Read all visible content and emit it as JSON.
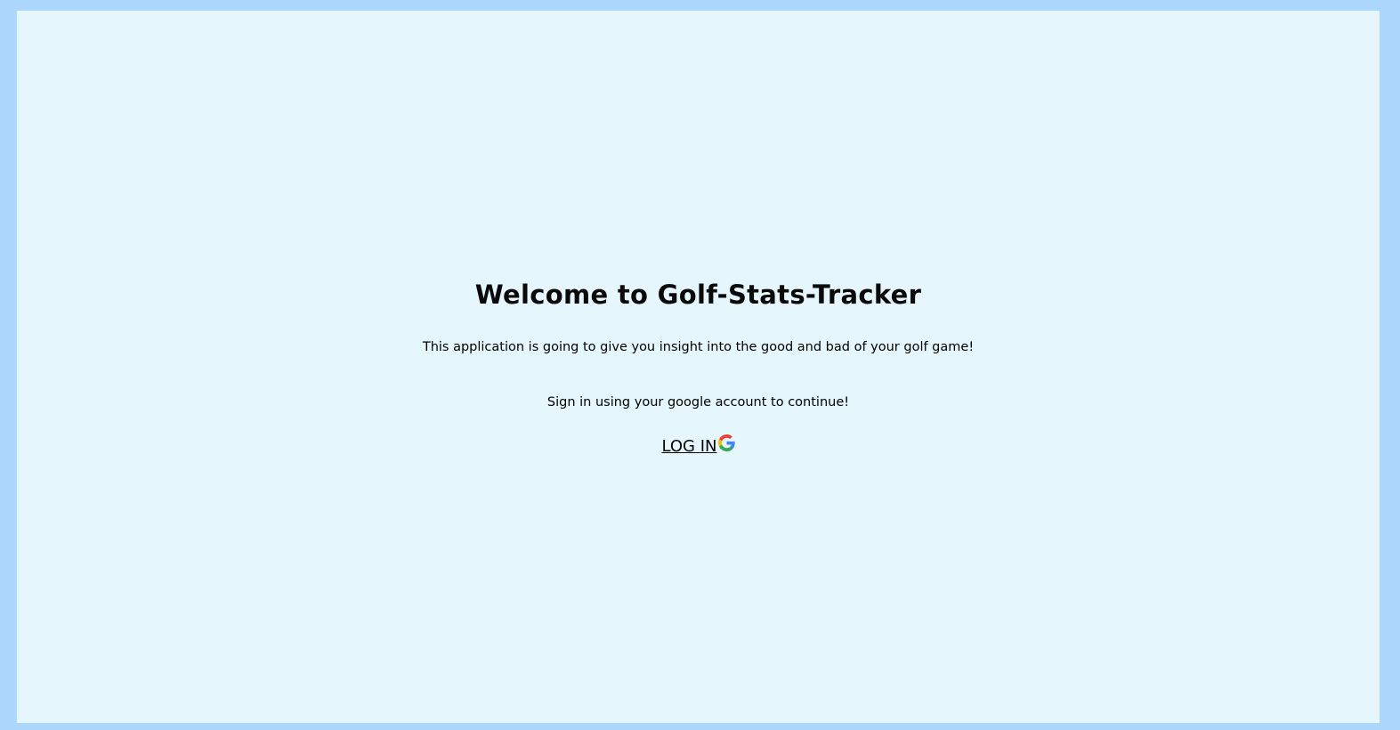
{
  "page": {
    "title": "Welcome to Golf-Stats-Tracker",
    "description": "This application is going to give you insight into the good and bad of your golf game!",
    "signin_prompt": "Sign in using your google account to continue!",
    "login_label": "LOG IN",
    "login_icon": "google-g-icon"
  },
  "colors": {
    "outer_background": "#add8fb",
    "panel_background": "#e5f7fc",
    "text": "#000000"
  }
}
